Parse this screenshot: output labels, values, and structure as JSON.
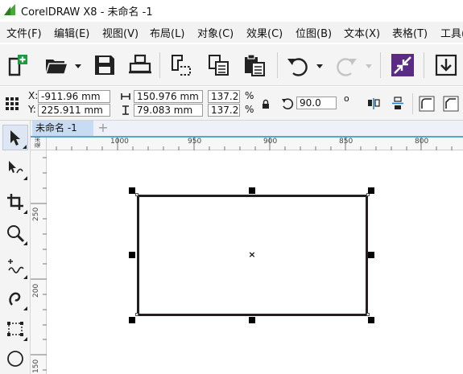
{
  "window": {
    "title": "CorelDRAW X8 - 未命名 -1"
  },
  "menu": [
    "文件(F)",
    "编辑(E)",
    "视图(V)",
    "布局(L)",
    "对象(C)",
    "效果(C)",
    "位图(B)",
    "文本(X)",
    "表格(T)",
    "工具("
  ],
  "toolbar": {
    "icons": [
      "new-document-icon",
      "open-folder-icon",
      "save-icon",
      "print-icon",
      "cut-icon",
      "copy-icon",
      "paste-icon",
      "undo-icon",
      "redo-icon",
      "import-icon",
      "export-icon"
    ]
  },
  "properties": {
    "x_label": "X:",
    "x_value": "-911.96 mm",
    "y_label": "Y:",
    "y_value": "225.911 mm",
    "width_value": "150.976 mm",
    "height_value": "79.083 mm",
    "scale_w": "137.2",
    "scale_h": "137.2",
    "percent": "%",
    "rotation": "90.0",
    "degree": "o"
  },
  "tools": [
    "pick-tool-icon",
    "shape-tool-icon",
    "crop-tool-icon",
    "zoom-tool-icon",
    "freehand-tool-icon",
    "artistic-media-tool-icon",
    "rectangle-tool-icon",
    "ellipse-tool-icon"
  ],
  "document_tab": {
    "label": "未命名 -1",
    "add": "+"
  },
  "ruler": {
    "h_labels": [
      "1000",
      "950",
      "900",
      "850",
      "800"
    ],
    "v_labels": [
      "250",
      "200",
      "150"
    ],
    "unit_mark": "毫米"
  },
  "canvas": {
    "center_mark": "×"
  },
  "colors": {
    "accent": "#5aa5c8",
    "tab_active": "#c7dcf3",
    "logo_green": "#4aa83a",
    "export_purple": "#5b2a86"
  }
}
